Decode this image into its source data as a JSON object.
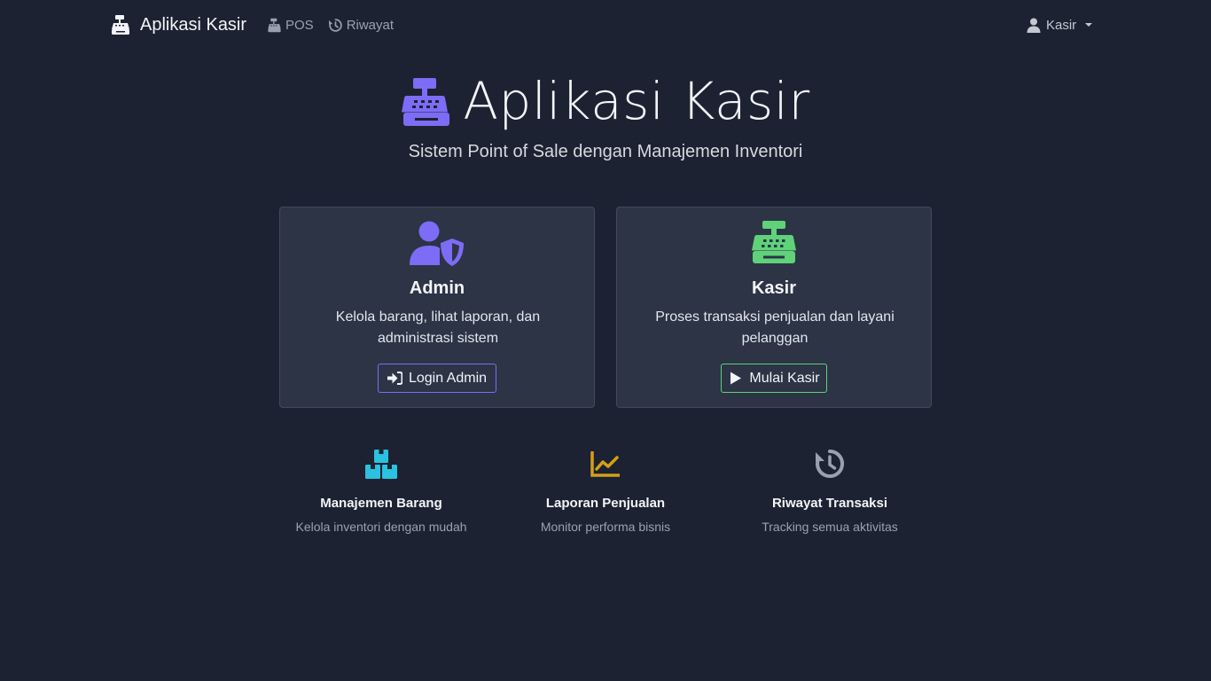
{
  "navbar": {
    "brand": "Aplikasi Kasir",
    "links": [
      {
        "label": "POS",
        "icon": "cash-register-icon"
      },
      {
        "label": "Riwayat",
        "icon": "history-icon"
      }
    ],
    "user": {
      "label": "Kasir",
      "icon": "user-icon"
    }
  },
  "hero": {
    "title": "Aplikasi Kasir",
    "subtitle": "Sistem Point of Sale dengan Manajemen Inventori"
  },
  "cards": [
    {
      "title": "Admin",
      "description": "Kelola barang, lihat laporan, dan administrasi sistem",
      "button": "Login Admin",
      "icon": "user-shield-icon",
      "accent": "#7d6cf5"
    },
    {
      "title": "Kasir",
      "description": "Proses transaksi penjualan dan layani pelanggan",
      "button": "Mulai Kasir",
      "icon": "cash-register-icon",
      "accent": "#5fd27a"
    }
  ],
  "features": [
    {
      "title": "Manajemen Barang",
      "description": "Kelola inventori dengan mudah",
      "icon": "boxes-icon",
      "color": "#2bc1e0"
    },
    {
      "title": "Laporan Penjualan",
      "description": "Monitor performa bisnis",
      "icon": "chart-line-icon",
      "color": "#d4a017"
    },
    {
      "title": "Riwayat Transaksi",
      "description": "Tracking semua aktivitas",
      "icon": "history-icon",
      "color": "#9aa1ae"
    }
  ],
  "colors": {
    "background": "#1c2231",
    "card": "#2c3446",
    "primary": "#7d6cf5",
    "success": "#5fd27a"
  }
}
